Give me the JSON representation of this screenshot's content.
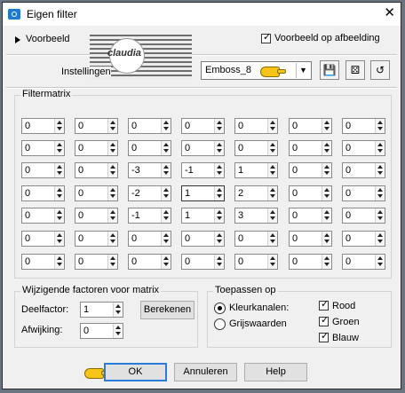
{
  "window": {
    "title": "Eigen filter",
    "close_glyph": "✕"
  },
  "preview": {
    "toggle_label": "Voorbeeld",
    "checkbox_label": "Voorbeeld op afbeelding",
    "checked": true
  },
  "watermark": {
    "text": "claudia"
  },
  "settings": {
    "label": "Instellingen",
    "selected_preset": "Emboss_8"
  },
  "toolbar": {
    "icons": [
      "save-icon",
      "random-icon",
      "reset-icon"
    ]
  },
  "matrix": {
    "title": "Filtermatrix",
    "rows": [
      [
        "0",
        "0",
        "0",
        "0",
        "0",
        "0",
        "0"
      ],
      [
        "0",
        "0",
        "0",
        "0",
        "0",
        "0",
        "0"
      ],
      [
        "0",
        "0",
        "-3",
        "-1",
        "1",
        "0",
        "0"
      ],
      [
        "0",
        "0",
        "-2",
        "1",
        "2",
        "0",
        "0"
      ],
      [
        "0",
        "0",
        "-1",
        "1",
        "3",
        "0",
        "0"
      ],
      [
        "0",
        "0",
        "0",
        "0",
        "0",
        "0",
        "0"
      ],
      [
        "0",
        "0",
        "0",
        "0",
        "0",
        "0",
        "0"
      ]
    ]
  },
  "factors": {
    "title": "Wijzigende factoren voor matrix",
    "divisor_label": "Deelfactor:",
    "divisor_value": "1",
    "calc_button": "Berekenen",
    "bias_label": "Afwijking:",
    "bias_value": "0"
  },
  "apply": {
    "title": "Toepassen op",
    "radio_color": "Kleurkanalen:",
    "radio_gray": "Grijswaarden",
    "selected": "Kleurkanalen:",
    "channels": [
      {
        "label": "Rood",
        "checked": true
      },
      {
        "label": "Groen",
        "checked": true
      },
      {
        "label": "Blauw",
        "checked": true
      }
    ]
  },
  "buttons": {
    "ok": "OK",
    "cancel": "Annuleren",
    "help": "Help"
  },
  "colors": {
    "focus_blue": "#2b7bd8",
    "pointer_yellow": "#f7c517"
  }
}
